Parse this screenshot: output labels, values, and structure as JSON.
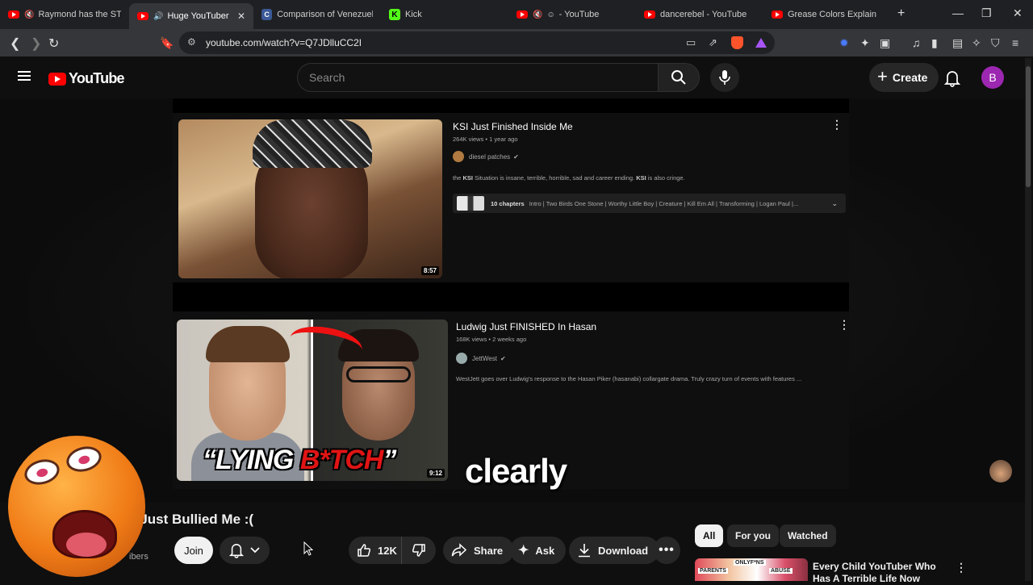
{
  "tabs": [
    {
      "title": "Raymond has the STAI",
      "muted": true,
      "active": false
    },
    {
      "title": "Huge YouTuber Ju",
      "muted": false,
      "active": true
    },
    {
      "title": "Comparison of Venezuela",
      "active": false
    },
    {
      "title": "Kick",
      "active": false
    },
    {
      "title": "- YouTube",
      "muted": true,
      "active": false
    },
    {
      "title": "dancerebel - YouTube",
      "active": false
    },
    {
      "title": "Grease Colors Explained",
      "active": false
    }
  ],
  "address": {
    "url": "youtube.com/watch?v=Q7JDlluCC2I"
  },
  "header": {
    "logo_text": "YouTube",
    "search_placeholder": "Search",
    "create_label": "Create",
    "avatar_letter": "B"
  },
  "player": {
    "cards": [
      {
        "title": "KSI Just Finished Inside Me",
        "meta": "264K views • 1 year ago",
        "channel": "diesel patches",
        "description_pre": "the ",
        "description_bold1": "KSI",
        "description_mid": " Situation is insane, terrible, horrible, sad and career ending. ",
        "description_bold2": "KSI",
        "description_post": " is also cringe.",
        "chapters_count": "10 chapters",
        "chapters_list": "Intro | Two Birds One Stone | Worthy Little Boy | Creature | Kill Em All | Transforming | Logan Paul |...",
        "duration": "8:57"
      },
      {
        "title": "Ludwig Just FINISHED In Hasan",
        "meta": "168K views • 2 weeks ago",
        "channel": "JettWest",
        "description": "WestJett goes over Ludwig's response to the Hasan Piker (hasanabi) collargate drama. Truly crazy turn of events with features ...",
        "thumb_text_white": "“LYING ",
        "thumb_text_red": "B*TCH",
        "thumb_text_end": "”",
        "duration": "9:12"
      }
    ],
    "caption": "clearly"
  },
  "video": {
    "title": "r Just Bullied Me :(",
    "subscribers": "ibers",
    "join_label": "Join",
    "like_count": "12K",
    "share_label": "Share",
    "ask_label": "Ask",
    "download_label": "Download"
  },
  "chips": [
    "All",
    "For you",
    "Watched"
  ],
  "recommendation": {
    "title": "Every Child YouTuber Who Has A Terrible Life Now",
    "thumb_labels": [
      "PARENTS",
      "ONLYF*NS",
      "ABUSE"
    ]
  },
  "colors": {
    "accent": "#ff0000",
    "avatar": "#9c27b0",
    "background": "#0f0f0f"
  }
}
